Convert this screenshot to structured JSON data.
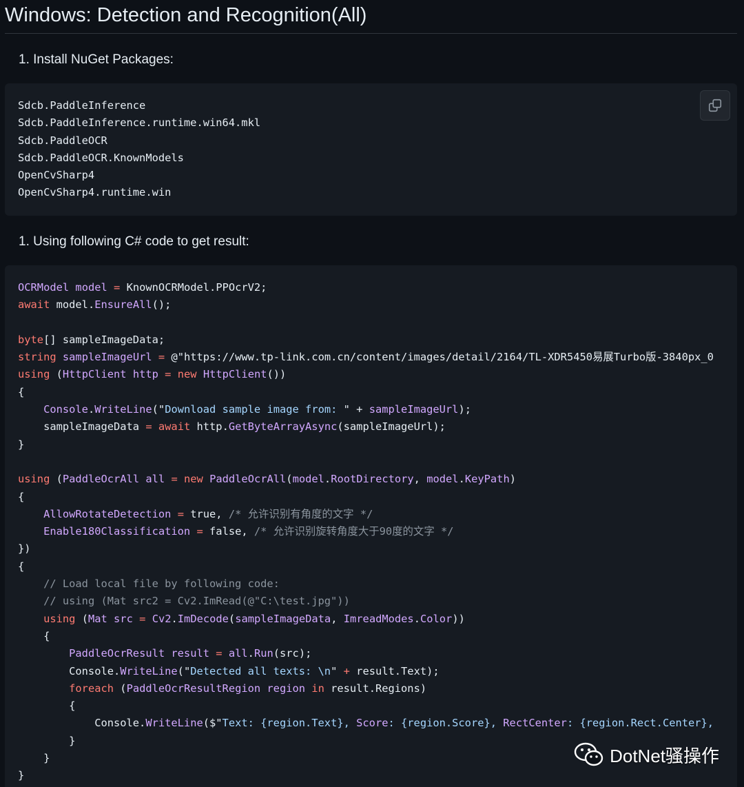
{
  "page": {
    "title": "Windows: Detection and Recognition(All)"
  },
  "steps": {
    "install_label": "1. Install NuGet Packages:",
    "code_label": "1. Using following C# code to get result:"
  },
  "packages": {
    "lines": [
      "Sdcb.PaddleInference",
      "Sdcb.PaddleInference.runtime.win64.mkl",
      "Sdcb.PaddleOCR",
      "Sdcb.PaddleOCR.KnownModels",
      "OpenCvSharp4",
      "OpenCvSharp4.runtime.win"
    ]
  },
  "code": {
    "lines": [
      [
        [
          "ty",
          "OCRModel"
        ],
        [
          "t",
          " "
        ],
        [
          "ty",
          "model"
        ],
        [
          "t",
          " "
        ],
        [
          "op",
          "="
        ],
        [
          "t",
          " KnownOCRModel.PPOcrV2;"
        ]
      ],
      [
        [
          "kw",
          "await"
        ],
        [
          "t",
          " model."
        ],
        [
          "fn",
          "EnsureAll"
        ],
        [
          "t",
          "();"
        ]
      ],
      [],
      [
        [
          "kw",
          "byte"
        ],
        [
          "t",
          "[] sampleImageData;"
        ]
      ],
      [
        [
          "kw",
          "string"
        ],
        [
          "t",
          " "
        ],
        [
          "ty",
          "sampleImageUrl"
        ],
        [
          "t",
          " "
        ],
        [
          "op",
          "="
        ],
        [
          "t",
          " @\"https://www.tp-link.com.cn/content/images/detail/2164/TL-XDR5450易展Turbo版-3840px_0"
        ]
      ],
      [
        [
          "kw",
          "using"
        ],
        [
          "t",
          " ("
        ],
        [
          "ty",
          "HttpClient http"
        ],
        [
          "t",
          " "
        ],
        [
          "op",
          "="
        ],
        [
          "t",
          " "
        ],
        [
          "kw",
          "new"
        ],
        [
          "t",
          " "
        ],
        [
          "ty",
          "HttpClient"
        ],
        [
          "t",
          "())"
        ]
      ],
      [
        [
          "t",
          "{"
        ]
      ],
      [
        [
          "t",
          "    "
        ],
        [
          "ty",
          "Console"
        ],
        [
          "t",
          "."
        ],
        [
          "fn",
          "WriteLine"
        ],
        [
          "t",
          "(\""
        ],
        [
          "st",
          "Download sample image from: "
        ],
        [
          "t",
          "\" + "
        ],
        [
          "ty",
          "sampleImageUrl"
        ],
        [
          "t",
          ");"
        ]
      ],
      [
        [
          "t",
          "    sampleImageData "
        ],
        [
          "op",
          "="
        ],
        [
          "t",
          " "
        ],
        [
          "kw",
          "await"
        ],
        [
          "t",
          " http."
        ],
        [
          "fn",
          "GetByteArrayAsync"
        ],
        [
          "t",
          "(sampleImageUrl);"
        ]
      ],
      [
        [
          "t",
          "}"
        ]
      ],
      [],
      [
        [
          "kw",
          "using"
        ],
        [
          "t",
          " ("
        ],
        [
          "ty",
          "PaddleOcrAll all"
        ],
        [
          "t",
          " "
        ],
        [
          "op",
          "="
        ],
        [
          "t",
          " "
        ],
        [
          "kw",
          "new"
        ],
        [
          "t",
          " "
        ],
        [
          "ty",
          "PaddleOcrAll"
        ],
        [
          "t",
          "("
        ],
        [
          "ty",
          "model"
        ],
        [
          "t",
          "."
        ],
        [
          "fn",
          "RootDirectory"
        ],
        [
          "t",
          ", "
        ],
        [
          "ty",
          "model"
        ],
        [
          "t",
          "."
        ],
        [
          "fn",
          "KeyPath"
        ],
        [
          "t",
          ")"
        ]
      ],
      [
        [
          "t",
          "{"
        ]
      ],
      [
        [
          "t",
          "    "
        ],
        [
          "ty",
          "AllowRotateDetection"
        ],
        [
          "t",
          " "
        ],
        [
          "op",
          "="
        ],
        [
          "t",
          " true, "
        ],
        [
          "cm",
          "/* 允许识别有角度的文字 */"
        ]
      ],
      [
        [
          "t",
          "    "
        ],
        [
          "ty",
          "Enable180Classification"
        ],
        [
          "t",
          " "
        ],
        [
          "op",
          "="
        ],
        [
          "t",
          " false, "
        ],
        [
          "cm",
          "/* 允许识别旋转角度大于90度的文字 */"
        ]
      ],
      [
        [
          "t",
          "})"
        ]
      ],
      [
        [
          "t",
          "{"
        ]
      ],
      [
        [
          "t",
          "    "
        ],
        [
          "cm",
          "// Load local file by following code:"
        ]
      ],
      [
        [
          "t",
          "    "
        ],
        [
          "cm",
          "// using (Mat src2 = Cv2.ImRead(@\"C:\\test.jpg\"))"
        ]
      ],
      [
        [
          "t",
          "    "
        ],
        [
          "kw",
          "using"
        ],
        [
          "t",
          " ("
        ],
        [
          "ty",
          "Mat src"
        ],
        [
          "t",
          " "
        ],
        [
          "op",
          "="
        ],
        [
          "t",
          " "
        ],
        [
          "ty",
          "Cv2"
        ],
        [
          "t",
          "."
        ],
        [
          "fn",
          "ImDecode"
        ],
        [
          "t",
          "("
        ],
        [
          "ty",
          "sampleImageData"
        ],
        [
          "t",
          ", "
        ],
        [
          "ty",
          "ImreadModes"
        ],
        [
          "t",
          "."
        ],
        [
          "fn",
          "Color"
        ],
        [
          "t",
          "))"
        ]
      ],
      [
        [
          "t",
          "    {"
        ]
      ],
      [
        [
          "t",
          "        "
        ],
        [
          "ty",
          "PaddleOcrResult result"
        ],
        [
          "t",
          " "
        ],
        [
          "op",
          "="
        ],
        [
          "t",
          " "
        ],
        [
          "ty",
          "all"
        ],
        [
          "t",
          "."
        ],
        [
          "fn",
          "Run"
        ],
        [
          "t",
          "(src);"
        ]
      ],
      [
        [
          "t",
          "        Console."
        ],
        [
          "fn",
          "WriteLine"
        ],
        [
          "t",
          "(\""
        ],
        [
          "st",
          "Detected all texts: \\n"
        ],
        [
          "t",
          "\" "
        ],
        [
          "op",
          "+"
        ],
        [
          "t",
          " result.Text);"
        ]
      ],
      [
        [
          "t",
          "        "
        ],
        [
          "kw",
          "foreach"
        ],
        [
          "t",
          " ("
        ],
        [
          "ty",
          "PaddleOcrResultRegion region"
        ],
        [
          "t",
          " "
        ],
        [
          "kw",
          "in"
        ],
        [
          "t",
          " result.Regions)"
        ]
      ],
      [
        [
          "t",
          "        {"
        ]
      ],
      [
        [
          "t",
          "            Console."
        ],
        [
          "fn",
          "WriteLine"
        ],
        [
          "t",
          "($\""
        ],
        [
          "st",
          "Text: {region.Text}, "
        ],
        [
          "ty",
          "Score"
        ],
        [
          "st",
          ": {region.Score}, "
        ],
        [
          "ty",
          "RectCenter"
        ],
        [
          "st",
          ": {region.Rect.Center},"
        ]
      ],
      [
        [
          "t",
          "        }"
        ]
      ],
      [
        [
          "t",
          "    }"
        ]
      ],
      [
        [
          "t",
          "}"
        ]
      ]
    ]
  },
  "colors": {
    "background": "#0d1117",
    "code_background": "#161b22",
    "keyword": "#ff7b72",
    "type": "#d2a8ff",
    "string": "#a5d6ff",
    "comment": "#8b949e"
  },
  "icons": {
    "copy": "copy-icon",
    "wechat": "wechat-icon"
  },
  "watermark": {
    "label": "DotNet骚操作"
  }
}
